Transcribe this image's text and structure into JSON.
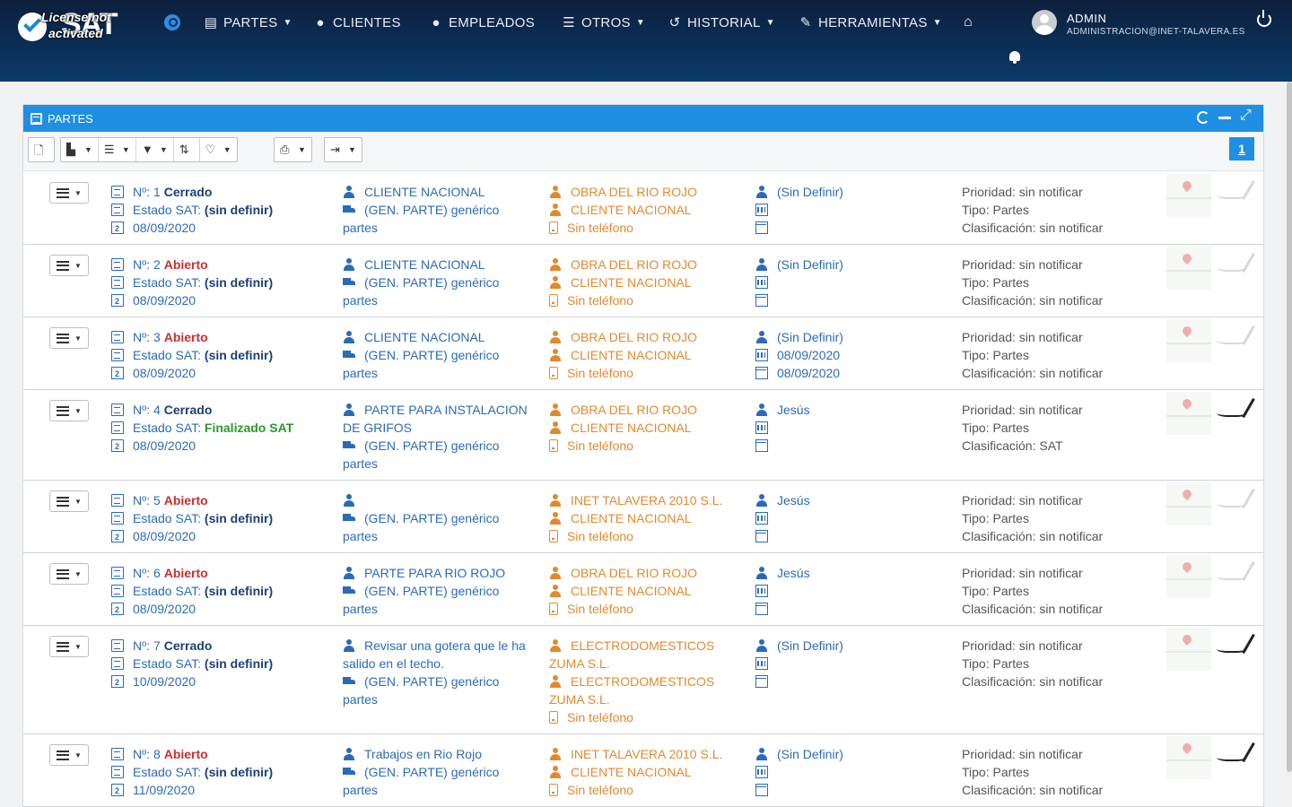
{
  "brand": {
    "logo": "SAT",
    "license_line1": "License not",
    "license_line2": "activated"
  },
  "nav": {
    "items": [
      {
        "label": "PARTES",
        "icon": "document-icon",
        "dropdown": true
      },
      {
        "label": "CLIENTES",
        "icon": "user-icon",
        "dropdown": false
      },
      {
        "label": "EMPLEADOS",
        "icon": "employee-icon",
        "dropdown": false
      },
      {
        "label": "OTROS",
        "icon": "list-icon",
        "dropdown": true
      },
      {
        "label": "HISTORIAL",
        "icon": "history-icon",
        "dropdown": true
      },
      {
        "label": "HERRAMIENTAS",
        "icon": "tools-icon",
        "dropdown": true
      }
    ]
  },
  "user": {
    "name": "ADMIN",
    "email": "ADMINISTRACION@INET-TALAVERA.ES"
  },
  "panel": {
    "title": "PARTES",
    "page": "1"
  },
  "colors": {
    "header_bg": "#0b3a6a",
    "panel_head": "#1f8fe3",
    "closed": "#1c3e78",
    "open": "#c83030",
    "finished": "#2a9a2a",
    "client": "#e08a2e",
    "link": "#2a6bb8"
  },
  "labels": {
    "num_prefix": "Nº:",
    "estado_prefix": "Estado SAT:",
    "prioridad": "Prioridad: sin notificar",
    "tipo": "Tipo: Partes",
    "phone": "Sin teléfono"
  },
  "rows": [
    {
      "num": "1",
      "status": "Cerrado",
      "status_kind": "closed",
      "estado": "(sin definir)",
      "estado_kind": "navy",
      "date": "08/09/2020",
      "desc": "CLIENTE NACIONAL",
      "generic": "(GEN. PARTE) genérico partes",
      "obra": "OBRA DEL RIO ROJO",
      "client": "CLIENTE NACIONAL",
      "tech": "(Sin Definir)",
      "d1": "",
      "d2": "",
      "clasif": "Clasificación: sin notificar",
      "sign": "faint"
    },
    {
      "num": "2",
      "status": "Abierto",
      "status_kind": "open",
      "estado": "(sin definir)",
      "estado_kind": "navy",
      "date": "08/09/2020",
      "desc": "CLIENTE NACIONAL",
      "generic": "(GEN. PARTE) genérico partes",
      "obra": "OBRA DEL RIO ROJO",
      "client": "CLIENTE NACIONAL",
      "tech": "(Sin Definir)",
      "d1": "",
      "d2": "",
      "clasif": "Clasificación: sin notificar",
      "sign": "faint"
    },
    {
      "num": "3",
      "status": "Abierto",
      "status_kind": "open",
      "estado": "(sin definir)",
      "estado_kind": "navy",
      "date": "08/09/2020",
      "desc": "CLIENTE NACIONAL",
      "generic": "(GEN. PARTE) genérico partes",
      "obra": "OBRA DEL RIO ROJO",
      "client": "CLIENTE NACIONAL",
      "tech": "(Sin Definir)",
      "d1": "08/09/2020",
      "d2": "08/09/2020",
      "clasif": "Clasificación: sin notificar",
      "sign": "faint"
    },
    {
      "num": "4",
      "status": "Cerrado",
      "status_kind": "closed",
      "estado": "Finalizado SAT",
      "estado_kind": "green",
      "date": "08/09/2020",
      "desc": "PARTE PARA INSTALACION DE GRIFOS",
      "generic": "(GEN. PARTE) genérico partes",
      "obra": "OBRA DEL RIO ROJO",
      "client": "CLIENTE NACIONAL",
      "tech": "Jesús",
      "d1": "",
      "d2": "",
      "clasif": "Clasificación: SAT",
      "sign": "dark"
    },
    {
      "num": "5",
      "status": "Abierto",
      "status_kind": "open",
      "estado": "(sin definir)",
      "estado_kind": "navy",
      "date": "08/09/2020",
      "desc": "",
      "generic": "(GEN. PARTE) genérico partes",
      "obra": "INET TALAVERA 2010 S.L.",
      "client": "CLIENTE NACIONAL",
      "tech": "Jesús",
      "d1": "",
      "d2": "",
      "clasif": "Clasificación: sin notificar",
      "sign": "faint"
    },
    {
      "num": "6",
      "status": "Abierto",
      "status_kind": "open",
      "estado": "(sin definir)",
      "estado_kind": "navy",
      "date": "08/09/2020",
      "desc": "PARTE PARA RIO ROJO",
      "generic": "(GEN. PARTE) genérico partes",
      "obra": "OBRA DEL RIO ROJO",
      "client": "CLIENTE NACIONAL",
      "tech": "Jesús",
      "d1": "",
      "d2": "",
      "clasif": "Clasificación: sin notificar",
      "sign": "faint"
    },
    {
      "num": "7",
      "status": "Cerrado",
      "status_kind": "closed",
      "estado": "(sin definir)",
      "estado_kind": "navy",
      "date": "10/09/2020",
      "desc": "Revisar una gotera que le ha salido en el techo.",
      "generic": "(GEN. PARTE) genérico partes",
      "obra": "ELECTRODOMESTICOS ZUMA S.L.",
      "client": "ELECTRODOMESTICOS ZUMA S.L.",
      "tech": "(Sin Definir)",
      "d1": "",
      "d2": "",
      "clasif": "Clasificación: sin notificar",
      "sign": "dark"
    },
    {
      "num": "8",
      "status": "Abierto",
      "status_kind": "open",
      "estado": "(sin definir)",
      "estado_kind": "navy",
      "date": "11/09/2020",
      "desc": "Trabajos en Rio Rojo",
      "generic": "(GEN. PARTE) genérico partes",
      "obra": "INET TALAVERA 2010 S.L.",
      "client": "CLIENTE NACIONAL",
      "tech": "(Sin Definir)",
      "d1": "",
      "d2": "",
      "clasif": "Clasificación: sin notificar",
      "sign": "dark"
    }
  ]
}
